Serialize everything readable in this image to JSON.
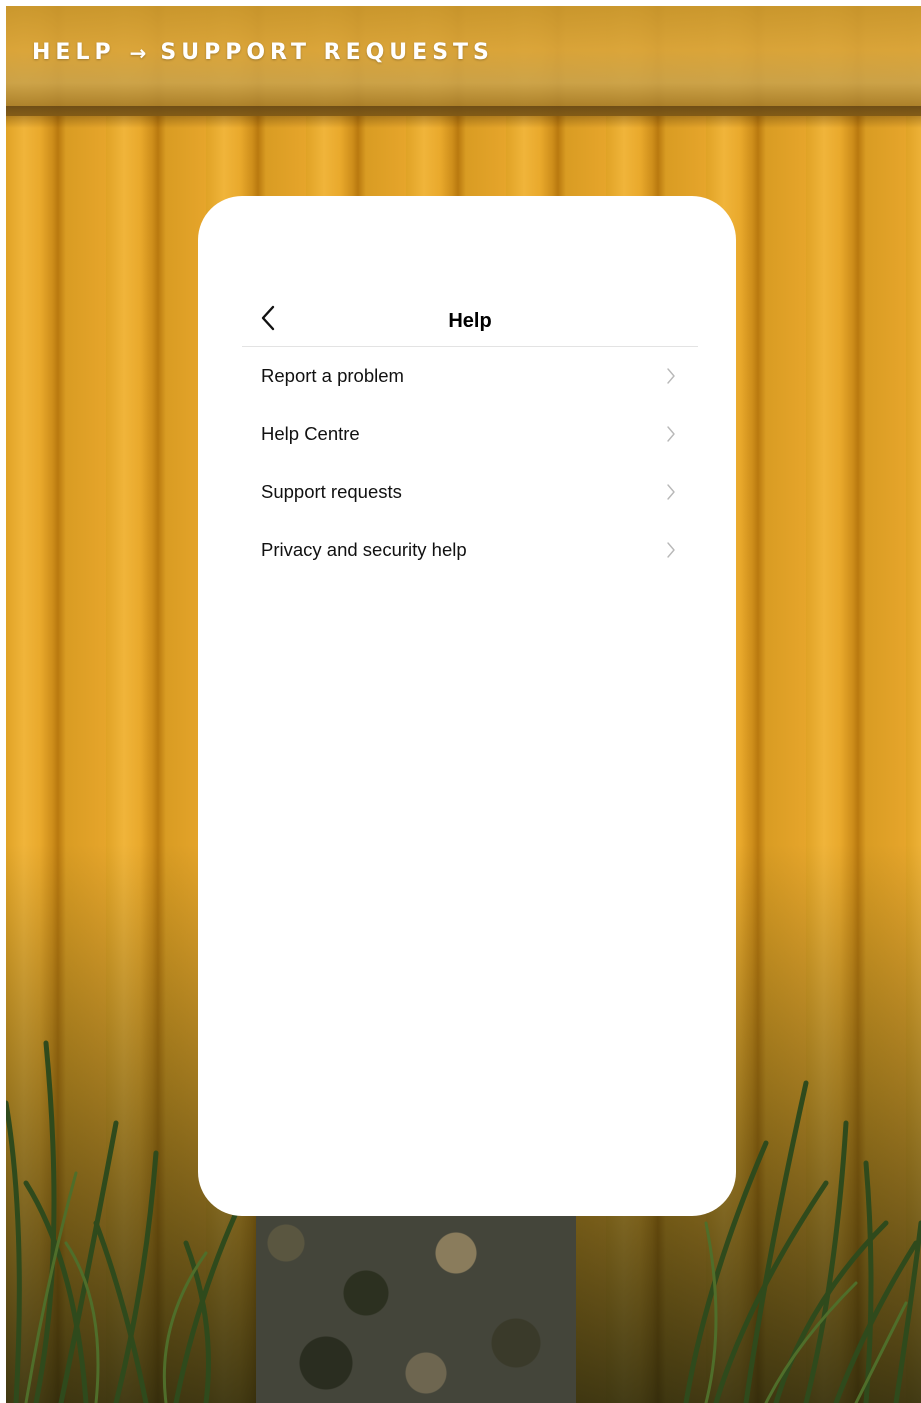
{
  "breadcrumb": {
    "parent": "HELP",
    "separator": "→",
    "current": "SUPPORT REQUESTS"
  },
  "screen": {
    "title": "Help",
    "back_icon": "chevron-left-icon"
  },
  "menu": {
    "items": [
      {
        "label": "Report a problem",
        "icon": "chevron-right-icon"
      },
      {
        "label": "Help Centre",
        "icon": "chevron-right-icon"
      },
      {
        "label": "Support requests",
        "icon": "chevron-right-icon"
      },
      {
        "label": "Privacy and security help",
        "icon": "chevron-right-icon"
      }
    ]
  },
  "colors": {
    "background_wall": "#e3a22a",
    "card": "#ffffff",
    "text": "#111111",
    "chevron": "#b8b8b8",
    "divider": "#e3e3e3"
  }
}
